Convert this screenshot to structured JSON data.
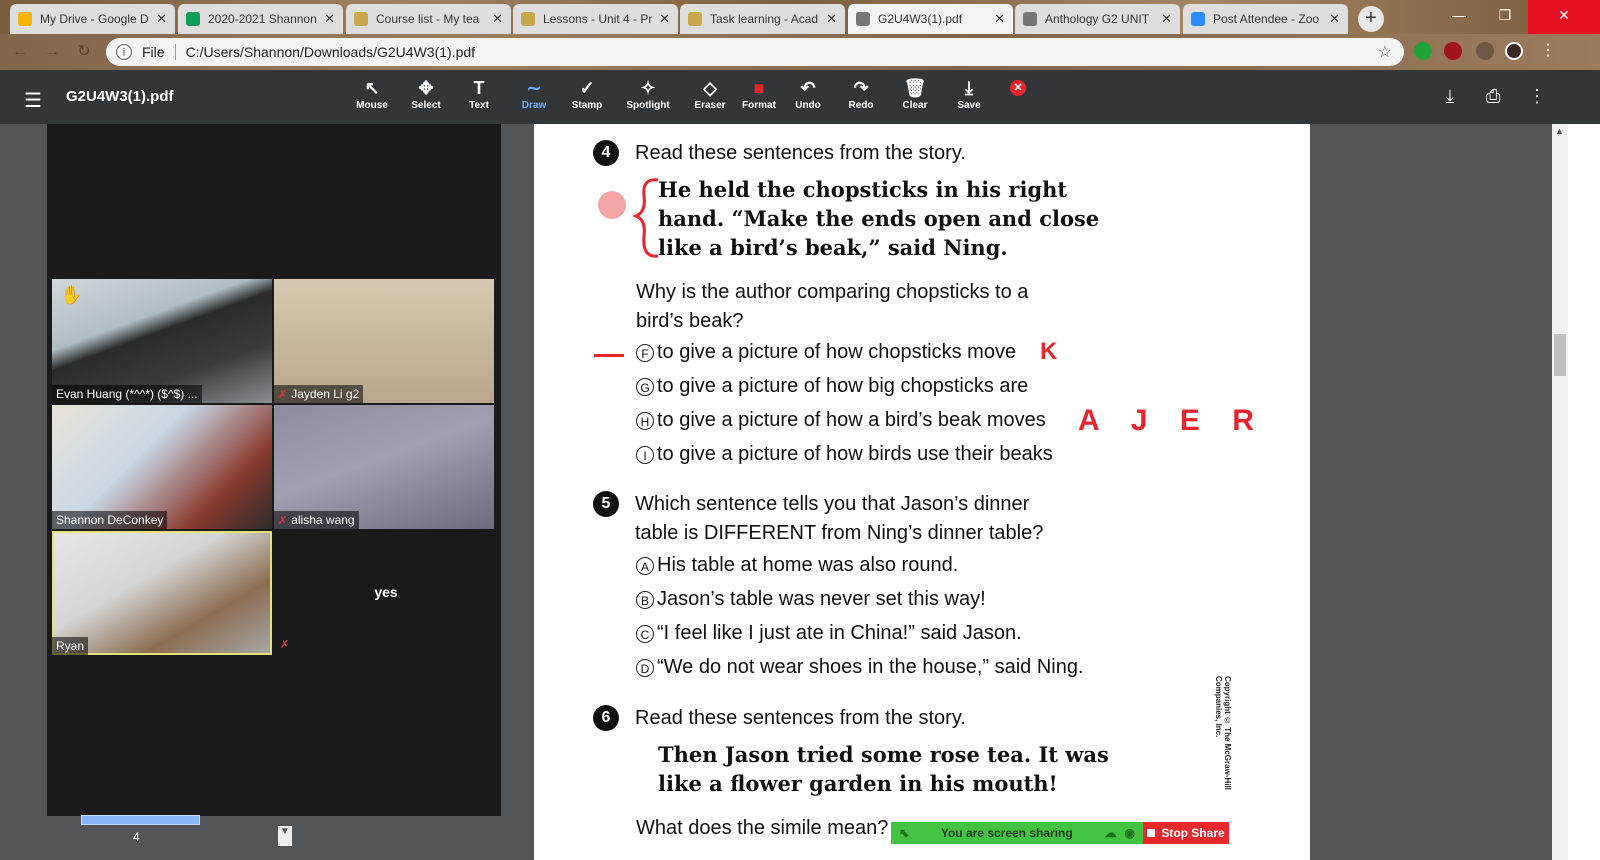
{
  "browser": {
    "tabs": [
      {
        "title": "My Drive - Google D",
        "fav_color": "#f4b400"
      },
      {
        "title": "2020-2021 Shannon",
        "fav_color": "#0f9d58"
      },
      {
        "title": "Course list - My tea",
        "fav_color": "#c8a84a"
      },
      {
        "title": "Lessons - Unit 4 - Pr",
        "fav_color": "#c8a84a"
      },
      {
        "title": "Task learning - Acad",
        "fav_color": "#c8a84a"
      },
      {
        "title": "G2U4W3(1).pdf",
        "fav_color": "#777777"
      },
      {
        "title": "Anthology G2 UNIT",
        "fav_color": "#777777"
      },
      {
        "title": "Post Attendee - Zoo",
        "fav_color": "#2d8cff"
      }
    ],
    "active_tab": 5,
    "address_scheme": "File",
    "address": "C:/Users/Shannon/Downloads/G2U4W3(1).pdf"
  },
  "pdf_toolbar": {
    "doc_name": "G2U4W3(1).pdf",
    "tools": [
      {
        "label": "Mouse",
        "icon": "↖"
      },
      {
        "label": "Select",
        "icon": "✥"
      },
      {
        "label": "Text",
        "icon": "T"
      },
      {
        "label": "Draw",
        "icon": "∼"
      },
      {
        "label": "Stamp",
        "icon": "✓"
      },
      {
        "label": "Spotlight",
        "icon": "✧"
      },
      {
        "label": "Eraser",
        "icon": "◇"
      },
      {
        "label": "Format",
        "icon": "■"
      },
      {
        "label": "Undo",
        "icon": "↶"
      },
      {
        "label": "Redo",
        "icon": "↷"
      },
      {
        "label": "Clear",
        "icon": "🗑"
      },
      {
        "label": "Save",
        "icon": "⤓"
      }
    ],
    "selected_tool": "Draw"
  },
  "gallery": {
    "participants": [
      {
        "name": "Evan Huang (*^^*) ($^$) ...",
        "muted": false,
        "raised_hand": true
      },
      {
        "name": "Jayden Li g2",
        "muted": true
      },
      {
        "name": "Shannon DeConkey",
        "muted": false
      },
      {
        "name": "alisha wang",
        "muted": true
      },
      {
        "name": "Ryan",
        "muted": false,
        "active_speaker": true
      },
      {
        "name": "yes",
        "muted": true,
        "video_off": true
      }
    ],
    "page_number": "4"
  },
  "pdf_page": {
    "q4": {
      "number": "4",
      "prompt": "Read these sentences from the story.",
      "quote": [
        "He held the chopsticks in his right",
        "hand. “Make the ends open and close",
        "like a bird’s beak,” said Ning."
      ],
      "question": [
        "Why is the author comparing chopsticks to a",
        "bird’s beak?"
      ],
      "options": [
        {
          "letter": "F",
          "text": "to give a picture of how chopsticks move"
        },
        {
          "letter": "G",
          "text": "to give a picture of how big chopsticks are"
        },
        {
          "letter": "H",
          "text": "to give a picture of how a bird’s beak moves"
        },
        {
          "letter": "I",
          "text": "to give a picture of how birds use their beaks"
        }
      ]
    },
    "q5": {
      "number": "5",
      "question": [
        "Which sentence tells you that Jason’s dinner",
        "table is DIFFERENT from Ning’s dinner table?"
      ],
      "options": [
        {
          "letter": "A",
          "text": "His table at home was also round."
        },
        {
          "letter": "B",
          "text": "Jason’s table was never set this way!"
        },
        {
          "letter": "C",
          "text": "“I feel like I just ate in China!” said Jason."
        },
        {
          "letter": "D",
          "text": "“We do not wear shoes in the house,” said Ning."
        }
      ]
    },
    "q6": {
      "number": "6",
      "prompt": "Read these sentences from the story.",
      "quote": [
        "Then Jason tried some rose tea. It was",
        "like a flower garden in his mouth!"
      ],
      "question": "What does the simile mean?"
    },
    "copyright": "Copyright © The McGraw-Hill Companies, Inc."
  },
  "annotations": {
    "mark_k": "K",
    "mark_ajer": "A J E R",
    "color": "#e8242c"
  },
  "share_bar": {
    "status": "You are screen sharing",
    "stop": "Stop Share"
  }
}
